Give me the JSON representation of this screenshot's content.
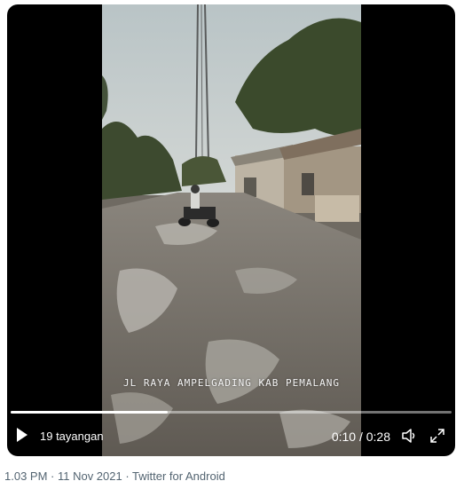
{
  "video": {
    "caption": "JL RAYA AMPELGADING KAB PEMALANG",
    "views": "19 tayangan",
    "time": "0:10 / 0:28",
    "progress": 0.357
  },
  "tweet_meta": {
    "timestamp": "1.03 PM · 11 Nov 2021 · Twitter for Android"
  }
}
